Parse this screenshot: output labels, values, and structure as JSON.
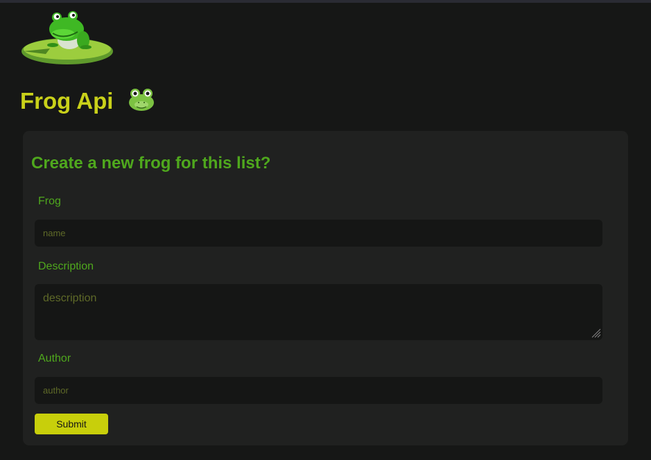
{
  "header": {
    "title": "Frog Api",
    "title_emoji_icon": "frog-face-icon",
    "logo_icon": "frog-on-lily-pad-icon"
  },
  "form": {
    "heading": "Create a new frog for this list?",
    "fields": [
      {
        "label": "Frog",
        "placeholder": "name",
        "value": ""
      },
      {
        "label": "Description",
        "placeholder": "description",
        "value": ""
      },
      {
        "label": "Author",
        "placeholder": "author",
        "value": ""
      }
    ],
    "submit_label": "Submit"
  },
  "colors": {
    "background": "#161716",
    "panel": "#202120",
    "input_background": "#151615",
    "title_yellow": "#c9d11a",
    "label_green": "#4fa81d",
    "button": "#c8cf0b"
  }
}
